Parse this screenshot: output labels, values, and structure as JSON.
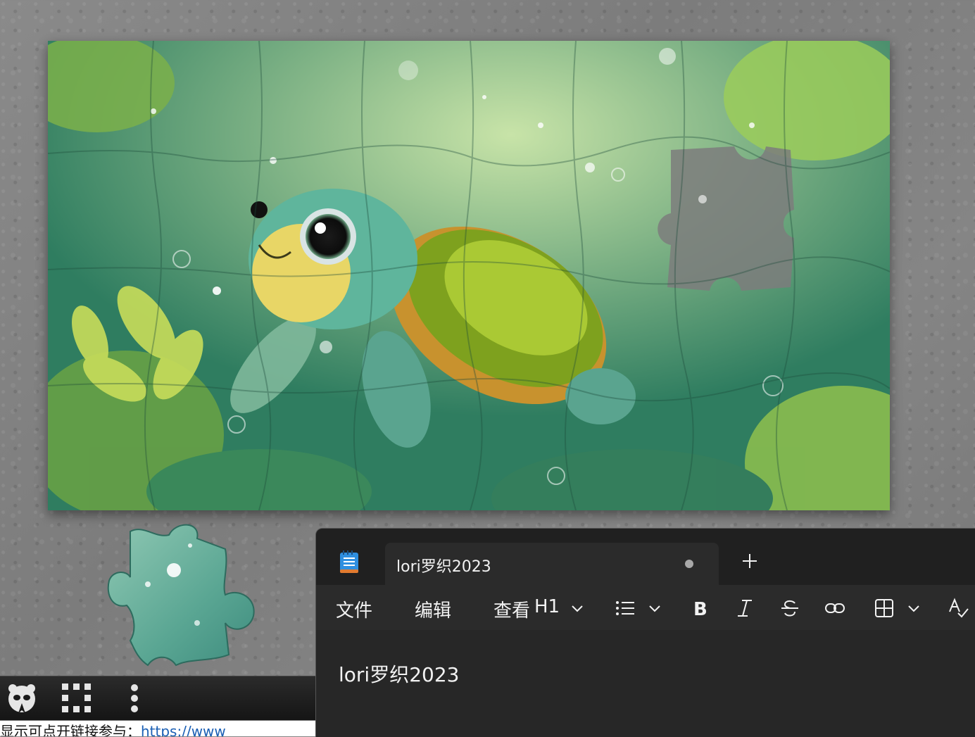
{
  "game": {
    "board_image": "sea-turtle-underwater-illustration",
    "toolbar": {
      "mascot_icon": "panda-mascot-icon",
      "grid_icon": "grid-dots-icon",
      "more_icon": "more-vertical-icon"
    },
    "bottom_text": "显示可点开链接参与：",
    "bottom_link": "https://www"
  },
  "notepad": {
    "tab_title": "lori罗织2023",
    "tab_unsaved_indicator": "●",
    "new_tab_icon": "plus-icon",
    "menu": {
      "file": "文件",
      "edit": "编辑",
      "view": "查看"
    },
    "format": {
      "heading": "H1",
      "list_icon": "bulleted-list-icon",
      "bold_icon": "bold-icon",
      "italic_icon": "italic-icon",
      "strike_icon": "strikethrough-icon",
      "link_icon": "link-icon",
      "table_icon": "table-icon",
      "spellcheck_icon": "spellcheck-icon"
    },
    "content": "lori罗织2023"
  },
  "colors": {
    "notepad_bg": "#2b2b2b",
    "titlebar_bg": "#202020",
    "text": "#f2f2f2",
    "link": "#1a5fb4"
  }
}
